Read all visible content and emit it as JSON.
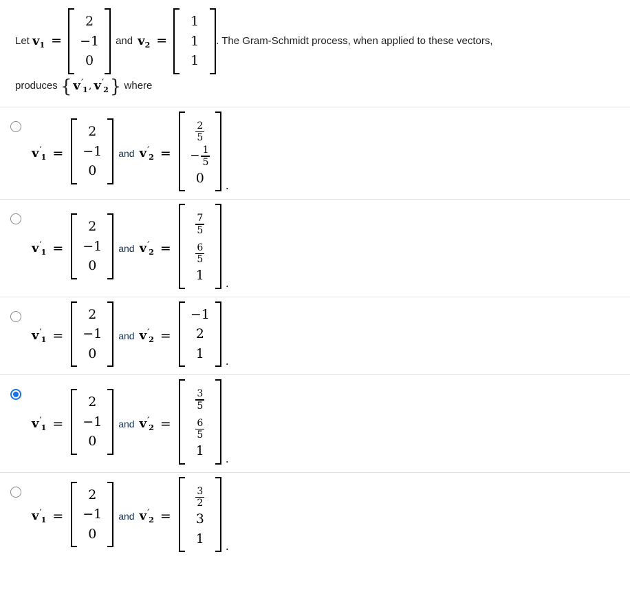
{
  "question": {
    "lead": "Let ",
    "v1_label": {
      "base": "v",
      "sub": "1"
    },
    "v1_vector": [
      "2",
      "−1",
      "0"
    ],
    "and": "and",
    "v2_label": {
      "base": "v",
      "sub": "2"
    },
    "v2_vector": [
      "1",
      "1",
      "1"
    ],
    "tail": ". The Gram-Schmidt process, when applied to these vectors,",
    "line2_prefix": "produces ",
    "brace_open": "{",
    "set_v1": {
      "base": "v",
      "prime": "′",
      "sub": "1"
    },
    "set_sep": ",",
    "set_v2": {
      "base": "v",
      "prime": "′",
      "sub": "2"
    },
    "brace_close": "}",
    "line2_suffix": " where"
  },
  "labels": {
    "v1_prime": {
      "base": "v",
      "prime": "′",
      "sub": "1"
    },
    "v2_prime": {
      "base": "v",
      "prime": "′",
      "sub": "2"
    },
    "equals": "=",
    "and": "and",
    "period": "."
  },
  "colors": {
    "accent_selected": "#1a73e8",
    "radio_border": "#8a8a8a",
    "separator": "#e2e2e2",
    "text": "#222222",
    "and_text": "#12325c"
  },
  "options": [
    {
      "id": "option-1",
      "selected": false,
      "v1": [
        {
          "type": "int",
          "value": "2"
        },
        {
          "type": "int",
          "value": "−1"
        },
        {
          "type": "int",
          "value": "0"
        }
      ],
      "v2": [
        {
          "type": "frac",
          "num": "2",
          "den": "5",
          "sign": ""
        },
        {
          "type": "frac",
          "num": "1",
          "den": "5",
          "sign": "−"
        },
        {
          "type": "int",
          "value": "0"
        }
      ]
    },
    {
      "id": "option-2",
      "selected": false,
      "v1": [
        {
          "type": "int",
          "value": "2"
        },
        {
          "type": "int",
          "value": "−1"
        },
        {
          "type": "int",
          "value": "0"
        }
      ],
      "v2": [
        {
          "type": "frac",
          "num": "7",
          "den": "5",
          "sign": ""
        },
        {
          "type": "frac",
          "num": "6",
          "den": "5",
          "sign": ""
        },
        {
          "type": "int",
          "value": "1"
        }
      ]
    },
    {
      "id": "option-3",
      "selected": false,
      "v1": [
        {
          "type": "int",
          "value": "2"
        },
        {
          "type": "int",
          "value": "−1"
        },
        {
          "type": "int",
          "value": "0"
        }
      ],
      "v2": [
        {
          "type": "int",
          "value": "−1"
        },
        {
          "type": "int",
          "value": "2"
        },
        {
          "type": "int",
          "value": "1"
        }
      ]
    },
    {
      "id": "option-4",
      "selected": true,
      "v1": [
        {
          "type": "int",
          "value": "2"
        },
        {
          "type": "int",
          "value": "−1"
        },
        {
          "type": "int",
          "value": "0"
        }
      ],
      "v2": [
        {
          "type": "frac",
          "num": "3",
          "den": "5",
          "sign": ""
        },
        {
          "type": "frac",
          "num": "6",
          "den": "5",
          "sign": ""
        },
        {
          "type": "int",
          "value": "1"
        }
      ]
    },
    {
      "id": "option-5",
      "selected": false,
      "v1": [
        {
          "type": "int",
          "value": "2"
        },
        {
          "type": "int",
          "value": "−1"
        },
        {
          "type": "int",
          "value": "0"
        }
      ],
      "v2": [
        {
          "type": "frac",
          "num": "3",
          "den": "2",
          "sign": ""
        },
        {
          "type": "int",
          "value": "3"
        },
        {
          "type": "int",
          "value": "1"
        }
      ]
    }
  ]
}
